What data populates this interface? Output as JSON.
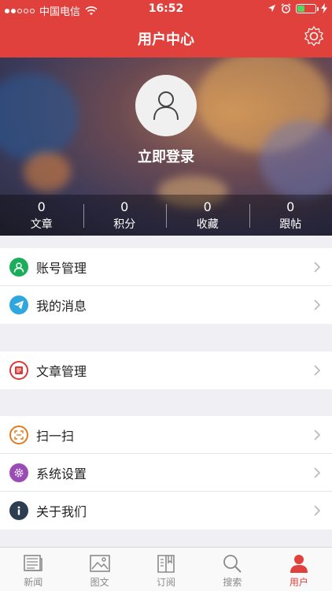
{
  "status": {
    "carrier": "中国电信",
    "time": "16:52",
    "battery_level": 0.4,
    "signal_dots_filled": 2,
    "signal_dots_total": 5
  },
  "header": {
    "title": "用户中心",
    "bg_color": "#e0413c"
  },
  "profile": {
    "login_label": "立即登录",
    "stats": [
      {
        "value": "0",
        "label": "文章"
      },
      {
        "value": "0",
        "label": "积分"
      },
      {
        "value": "0",
        "label": "收藏"
      },
      {
        "value": "0",
        "label": "跟帖"
      }
    ]
  },
  "menu": {
    "account": {
      "label": "账号管理",
      "icon": "user-icon",
      "color": "#1aad5a"
    },
    "messages": {
      "label": "我的消息",
      "icon": "paper-plane-icon",
      "color": "#2ea6e0"
    },
    "articles": {
      "label": "文章管理",
      "icon": "article-icon",
      "color": "#d93a3a"
    },
    "scan": {
      "label": "扫一扫",
      "icon": "scan-icon",
      "color": "#e07c1d"
    },
    "settings": {
      "label": "系统设置",
      "icon": "gear-icon",
      "color": "#9a4bb5"
    },
    "about": {
      "label": "关于我们",
      "icon": "info-icon",
      "color": "#2c3e50"
    }
  },
  "tabbar": {
    "tabs": [
      {
        "label": "新闻",
        "icon": "news-icon"
      },
      {
        "label": "图文",
        "icon": "image-icon"
      },
      {
        "label": "订阅",
        "icon": "book-icon"
      },
      {
        "label": "搜索",
        "icon": "search-icon"
      },
      {
        "label": "用户",
        "icon": "user-icon"
      }
    ],
    "active": "用户",
    "active_color": "#e0413c"
  }
}
